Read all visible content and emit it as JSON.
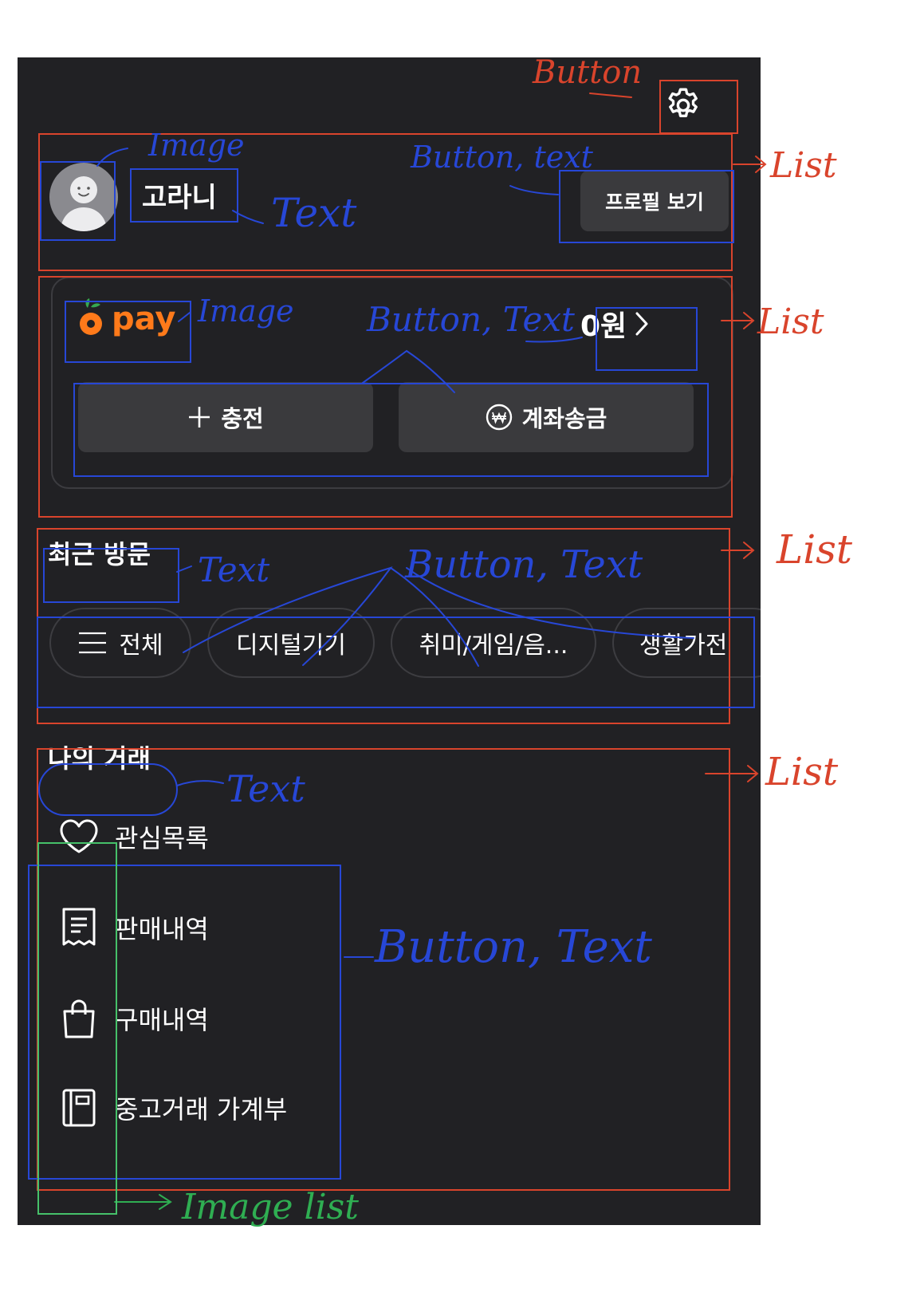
{
  "profile": {
    "name": "고라니",
    "view_profile_label": "프로필 보기"
  },
  "pay": {
    "brand_word": "pay",
    "balance": "0원",
    "charge_label": "충전",
    "transfer_label": "계좌송금"
  },
  "recent": {
    "title": "최근 방문",
    "chips": [
      "전체",
      "디지털기기",
      "취미/게임/음...",
      "생활가전"
    ]
  },
  "my_trade": {
    "title": "나의 거래",
    "items": [
      "관심목록",
      "판매내역",
      "구매내역",
      "중고거래 가계부"
    ]
  },
  "annotations": {
    "button": "Button",
    "image": "Image",
    "text": "Text",
    "button_text": "Button, Text",
    "button_text_lower": "Button, text",
    "list": "List",
    "image_list": "Image list"
  },
  "colors": {
    "background": "#212124",
    "surface": "#3a3a3d",
    "accent": "#ff7a1a",
    "annotation_red": "#d9442c",
    "annotation_blue": "#2747d6",
    "annotation_green": "#46c16a"
  },
  "icons": [
    "gear-icon",
    "avatar-icon",
    "carrot-icon",
    "chevron-right-icon",
    "plus-icon",
    "won-icon",
    "menu-icon",
    "heart-icon",
    "receipt-icon",
    "bag-icon",
    "ledger-icon"
  ]
}
